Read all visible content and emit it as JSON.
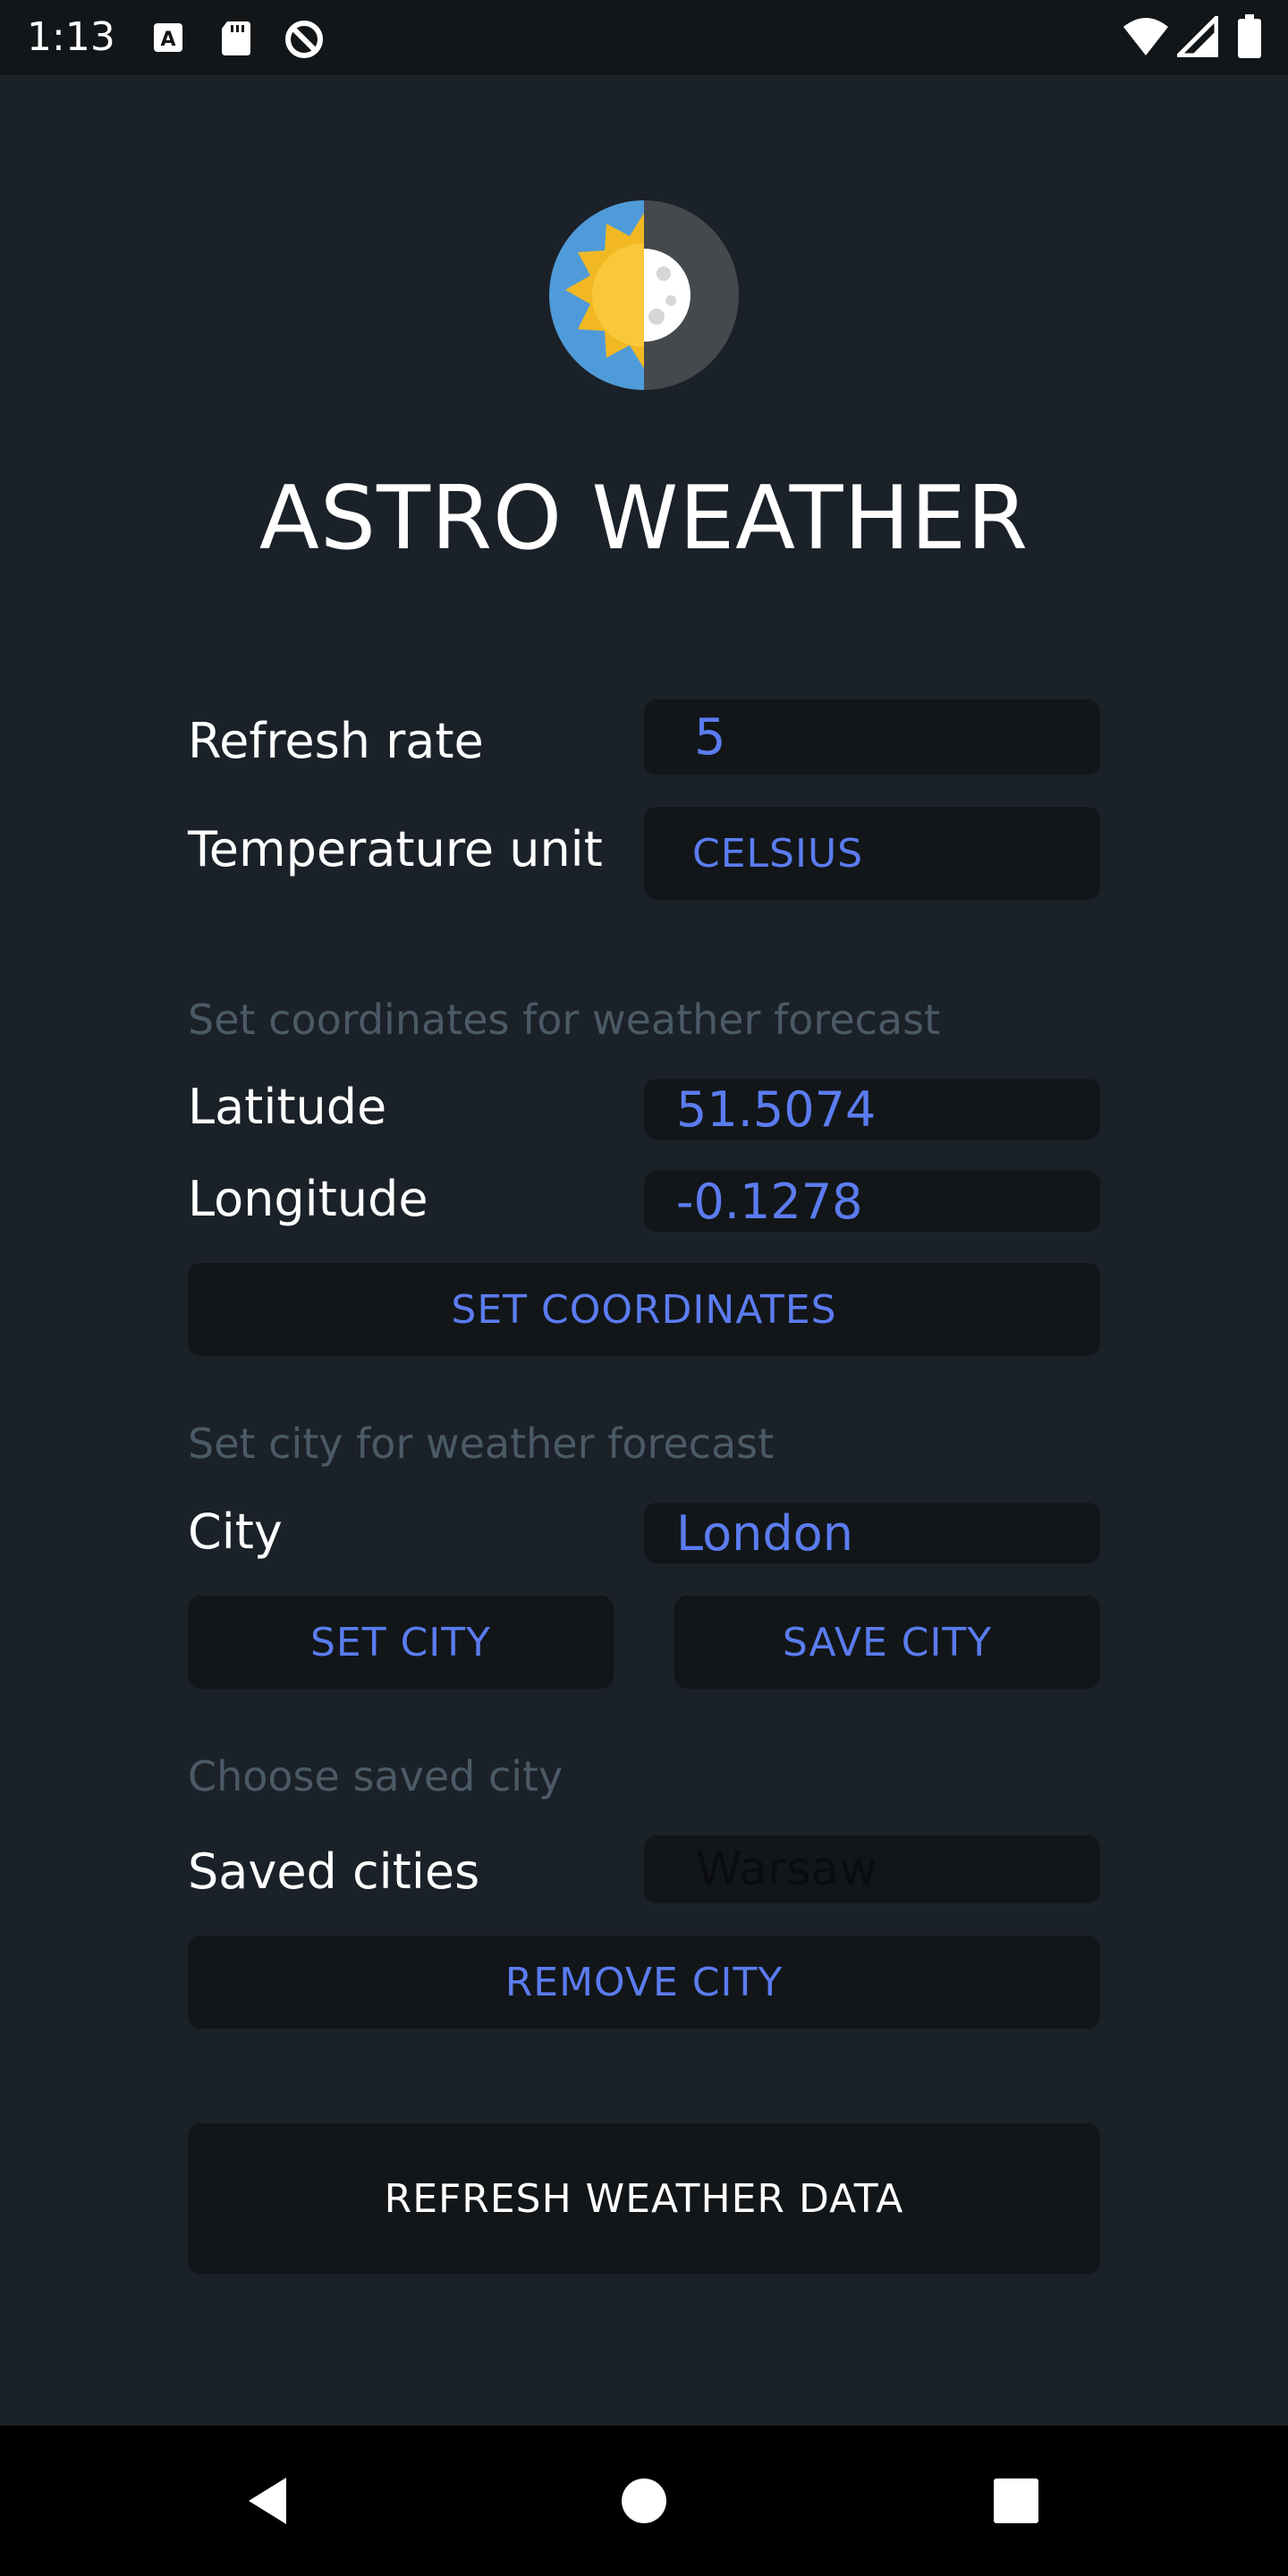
{
  "status_bar": {
    "time": "1:13",
    "icons": [
      "a-notification-icon",
      "sd-card-icon",
      "no-sync-icon",
      "wifi-icon",
      "signal-icon",
      "battery-icon"
    ]
  },
  "header": {
    "title": "ASTRO WEATHER",
    "logo_icon": "sun-moon-icon"
  },
  "settings": {
    "refresh_rate_label": "Refresh rate",
    "refresh_rate_value": "5",
    "temperature_unit_label": "Temperature unit",
    "temperature_unit_value": "CELSIUS"
  },
  "coordinates": {
    "hint": "Set coordinates for weather forecast",
    "latitude_label": "Latitude",
    "latitude_value": "51.5074",
    "longitude_label": "Longitude",
    "longitude_value": "-0.1278",
    "set_button": "SET COORDINATES"
  },
  "city": {
    "hint": "Set city for weather forecast",
    "city_label": "City",
    "city_value": "London",
    "set_button": "SET CITY",
    "save_button": "SAVE CITY"
  },
  "saved": {
    "hint": "Choose saved city",
    "label": "Saved cities",
    "selected": "Warsaw",
    "remove_button": "REMOVE CITY"
  },
  "refresh_button": "REFRESH WEATHER DATA",
  "nav": {
    "icons": [
      "back-icon",
      "home-icon",
      "recents-icon"
    ]
  },
  "colors": {
    "background": "#1b2128",
    "field_background": "#121619",
    "accent": "#5b7cf0",
    "hint": "#4a5a66"
  }
}
